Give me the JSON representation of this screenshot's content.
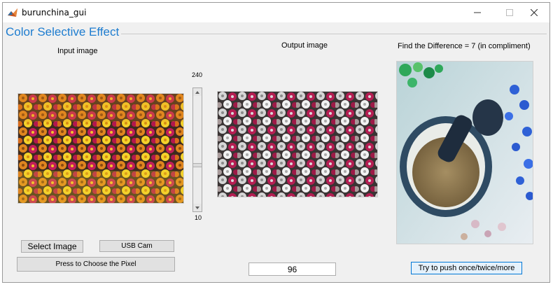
{
  "window": {
    "title": "burunchina_gui",
    "app_icon": "matlab-icon",
    "controls": [
      "minimize-icon",
      "maximize-icon",
      "close-icon"
    ]
  },
  "panel": {
    "title": "Color Selective Effect"
  },
  "input": {
    "label": "Input image",
    "image_desc": "flowers-input-image"
  },
  "slider": {
    "max_label": "240",
    "min_label": "10",
    "max": 240,
    "min": 10
  },
  "output": {
    "label": "Output image",
    "image_desc": "flowers-output-image",
    "value": "96"
  },
  "difference": {
    "label": "Find the Difference = 7 (in compliment)",
    "image_desc": "mortar-pestle-image",
    "button_label": "Try to push once/twice/more"
  },
  "buttons": {
    "select_image": "Select Image",
    "usb_cam": "USB Cam",
    "choose_pixel": "Press to Choose the Pixel"
  },
  "colors": {
    "panel_title": "#1d7ccf",
    "accent_border": "#0078d7"
  }
}
